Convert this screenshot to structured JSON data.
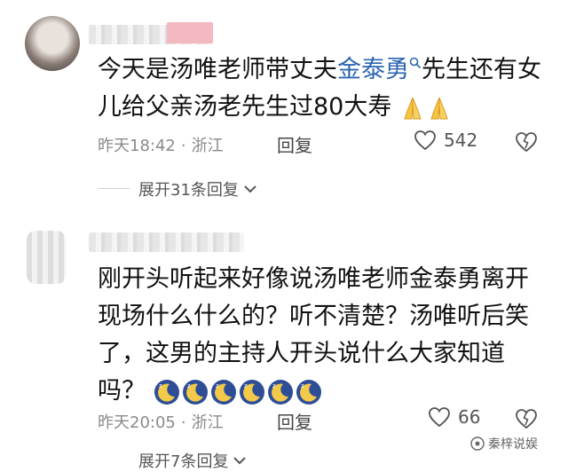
{
  "comment1": {
    "text_before_mention": "今天是汤唯老师带丈夫",
    "mention": "金泰勇",
    "text_line1_after": "先生还有女",
    "text_line2": "儿给父亲汤老先生过80大寿",
    "time": "昨天18:42",
    "location": "浙江",
    "reply": "回复",
    "likes": "542",
    "expand": "展开31条回复"
  },
  "comment2": {
    "lines": [
      "刚开头听起来好像说汤唯老师金泰勇离开",
      "现场什么什么的？听不清楚？汤唯听后笑",
      "了，这男的主持人开头说什么大家知道",
      "吗？"
    ],
    "time": "昨天20:05",
    "location": "浙江",
    "reply": "回复",
    "likes": "66",
    "expand": "展开7条回复"
  },
  "watermark": "秦梓说娱",
  "icons": {
    "pray": "folded-hands-icon",
    "moon": "sleeping-moon-icon",
    "like": "heart-icon",
    "dislike": "broken-heart-icon",
    "search": "search-icon",
    "chevron": "chevron-down-icon"
  },
  "colors": {
    "mention": "#2b66b1",
    "meta": "#8a8a8a",
    "moon_bg": "#2d4e96",
    "moon": "#f3c94a"
  }
}
